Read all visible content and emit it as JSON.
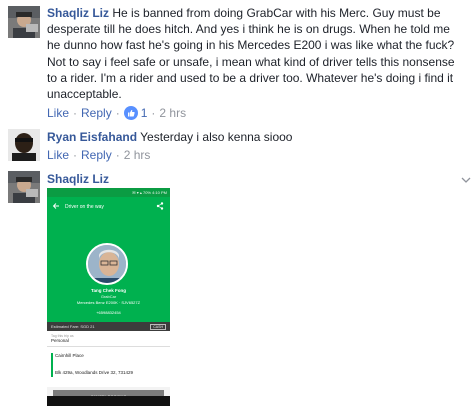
{
  "comments": [
    {
      "author": "Shaqliz Liz",
      "text": "He is banned from doing GrabCar with his Merc. Guy must be desperate till he does hitch. And yes i think he is on drugs. When he told me he dunno how fast he's going in his Mercedes E200 i was like what the fuck? Not to say i feel safe or unsafe, i mean what kind of driver tells this nonsense to a rider. I'm a rider and used to be a driver too. Whatever he's doing i find it unacceptable.",
      "like_label": "Like",
      "reply_label": "Reply",
      "like_count": "1",
      "time": "2 hrs"
    },
    {
      "author": "Ryan Eisfahand",
      "text": "Yesterday i also kenna siooo",
      "like_label": "Like",
      "reply_label": "Reply",
      "time": "2 hrs"
    },
    {
      "author": "Shaqliz Liz"
    }
  ],
  "separator": "·",
  "screenshot": {
    "status": "✉ ▾ ▴ 70% 4:10 PM",
    "title": "Driver on the way",
    "driver_name": "Tang Chek Fong",
    "service": "GrabCar",
    "car": "Mercedes Benz E200K · SJV6527Z",
    "phone": "+6598832454",
    "fare": "Estimated Fare: SGD 21",
    "payment": "CASH",
    "tag_label": "Tag this trip as",
    "tag_value": "Personal",
    "pickup": "Cairnhill Place",
    "dropoff": "Blk 429a, Woodlands Drive 32, 731429",
    "cancel_label": "CANCEL BOOKING"
  },
  "colors": {
    "name": "#365899",
    "link": "#4267b2",
    "muted": "#90949c",
    "grab_green": "#00b14f"
  }
}
